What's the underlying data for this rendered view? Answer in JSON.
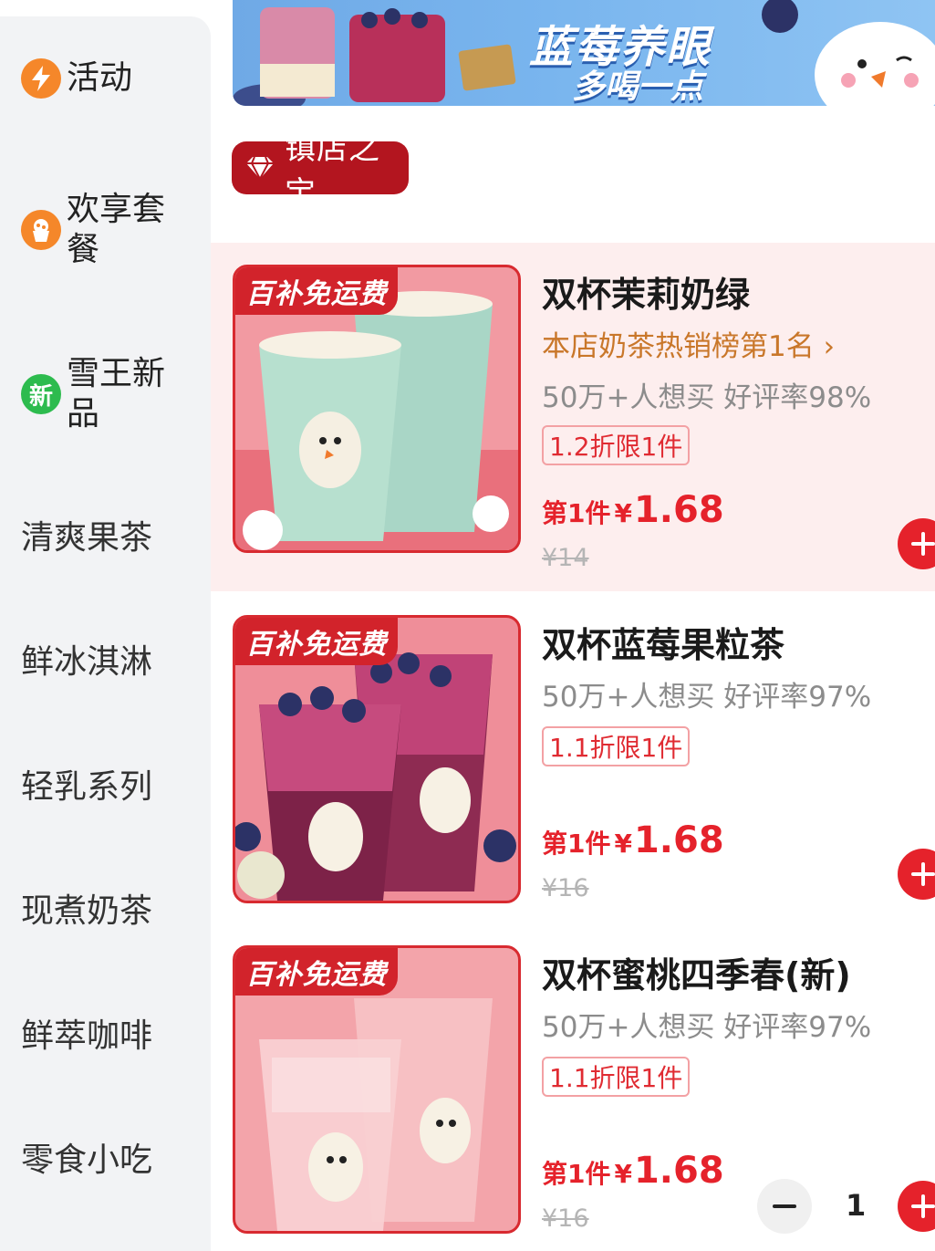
{
  "sidebar": {
    "items": [
      {
        "label": "活动",
        "icon": "lightning-icon"
      },
      {
        "label": "欢享套餐",
        "icon": "cupcake-icon"
      },
      {
        "label": "雪王新品",
        "icon": "new-badge-icon",
        "icon_text": "新"
      },
      {
        "label": "清爽果茶"
      },
      {
        "label": "鲜冰淇淋"
      },
      {
        "label": "轻乳系列"
      },
      {
        "label": "现煮奶茶"
      },
      {
        "label": "鲜萃咖啡"
      },
      {
        "label": "零食小吃"
      }
    ]
  },
  "banner": {
    "headline": "蓝莓养眼",
    "subline": "多喝一点"
  },
  "section": {
    "title": "镇店之宝",
    "icon": "diamond-icon"
  },
  "products": [
    {
      "tag": "百补免运费",
      "name": "双杯茉莉奶绿",
      "rank": "本店奶茶热销榜第1名 ›",
      "stats": "50万+人想买 好评率98%",
      "discount": "1.2折限1件",
      "price_label": "第1件",
      "currency": "¥",
      "price": "1.68",
      "original_price": "¥14"
    },
    {
      "tag": "百补免运费",
      "name": "双杯蓝莓果粒茶",
      "stats": "50万+人想买 好评率97%",
      "discount": "1.1折限1件",
      "price_label": "第1件",
      "currency": "¥",
      "price": "1.68",
      "original_price": "¥16"
    },
    {
      "tag": "百补免运费",
      "name": "双杯蜜桃四季春(新)",
      "stats": "50万+人想买 好评率97%",
      "discount": "1.1折限1件",
      "price_label": "第1件",
      "currency": "¥",
      "price": "1.68",
      "original_price": "¥16",
      "quantity": "1"
    }
  ],
  "colors": {
    "accent_red": "#e5222b",
    "badge_red": "#b3151f",
    "rank_orange": "#c9772a",
    "sidebar_bg": "#f2f3f5",
    "highlight_bg": "#fdeeee",
    "new_green": "#2dbb4e",
    "activity_orange": "#f5872a"
  }
}
